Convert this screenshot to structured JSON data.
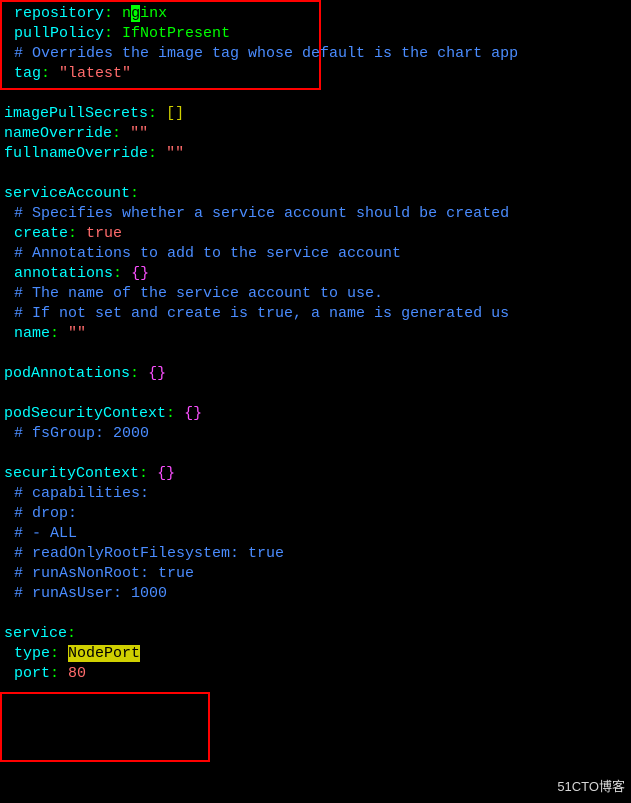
{
  "lines": {
    "l1_key": "repository",
    "l1_val_pre": "n",
    "l1_val_cursor": "g",
    "l1_val_post": "inx",
    "l2_key": "pullPolicy",
    "l2_val": "IfNotPresent",
    "l3": "# Overrides the image tag whose default is the chart app",
    "l4_key": "tag",
    "l4_val": "\"latest\"",
    "l5_key": "imagePullSecrets",
    "l6_key": "nameOverride",
    "l6_val": "\"\"",
    "l7_key": "fullnameOverride",
    "l7_val": "\"\"",
    "l8_key": "serviceAccount",
    "l9": "# Specifies whether a service account should be created",
    "l10_key": "create",
    "l10_val": "true",
    "l11": "# Annotations to add to the service account",
    "l12_key": "annotations",
    "l13": "# The name of the service account to use.",
    "l14": "# If not set and create is true, a name is generated us",
    "l15_key": "name",
    "l15_val": "\"\"",
    "l16_key": "podAnnotations",
    "l17_key": "podSecurityContext",
    "l18": "# fsGroup: 2000",
    "l19_key": "securityContext",
    "l20": "# capabilities:",
    "l21": "#   drop:",
    "l22": "#   - ALL",
    "l23": "# readOnlyRootFilesystem: true",
    "l24": "# runAsNonRoot: true",
    "l25": "# runAsUser: 1000",
    "l26_key": "service",
    "l27_key": "type",
    "l27_val": "NodePort",
    "l28_key": "port",
    "l28_val": "80"
  },
  "brackets": {
    "sq": "[]",
    "cu": "{}"
  },
  "colon": ":",
  "watermark": "51CTO博客"
}
